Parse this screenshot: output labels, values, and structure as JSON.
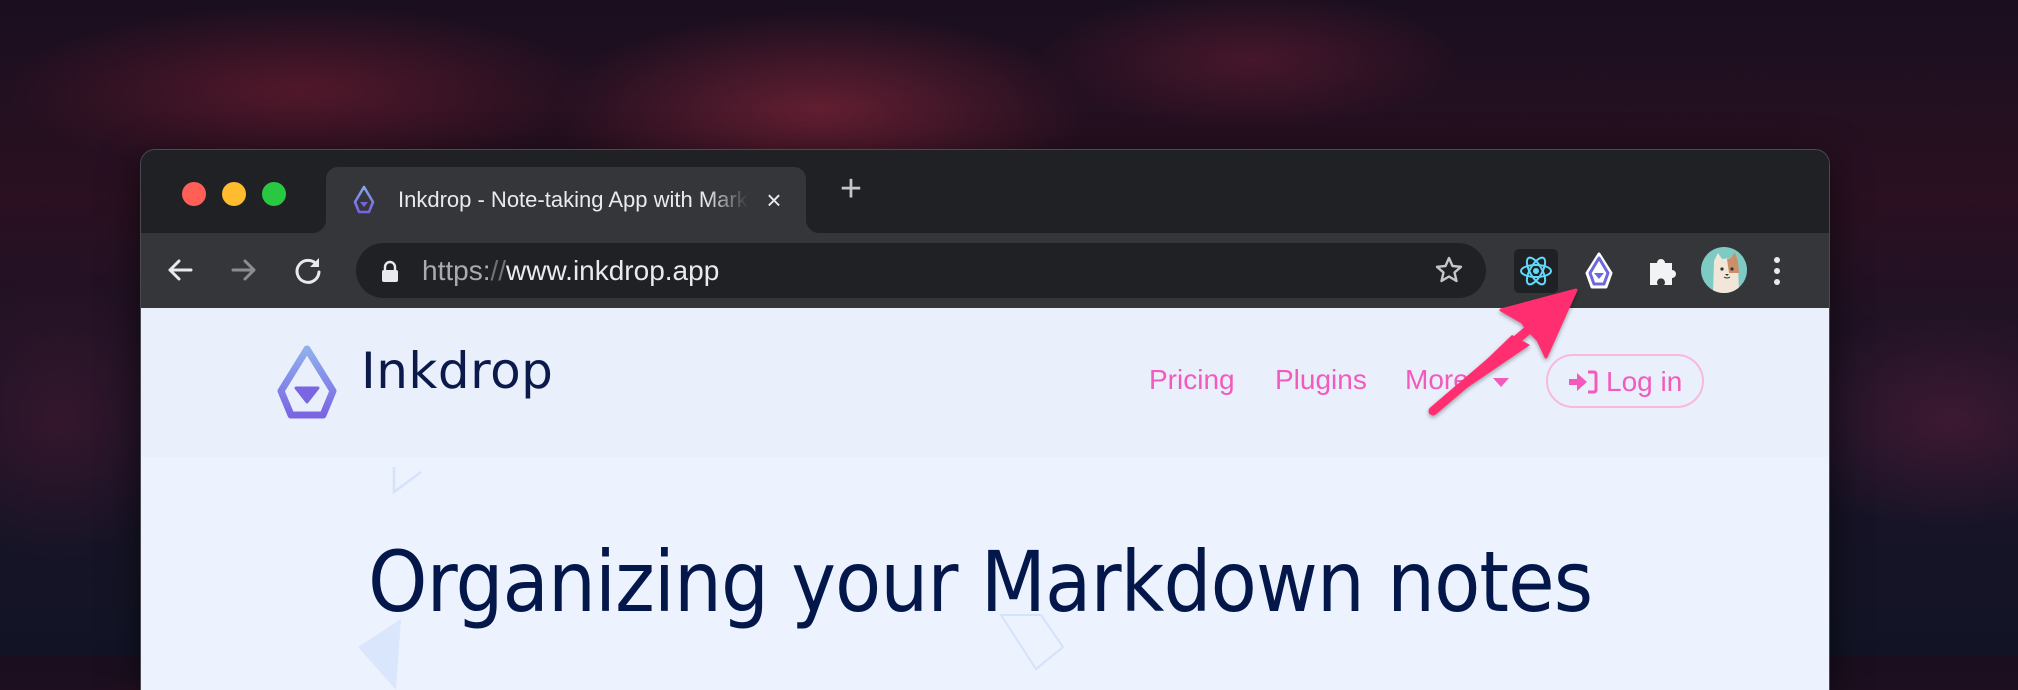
{
  "browser": {
    "tab": {
      "title": "Inkdrop - Note-taking App with Markdown",
      "favicon": "inkdrop-logo-icon",
      "close_icon": "×"
    },
    "new_tab_icon": "+",
    "omnibox": {
      "url_scheme": "https:",
      "url_separator": "//",
      "url_host": "www.inkdrop.app"
    },
    "extensions": [
      "react-devtools-icon",
      "inkdrop-extension-icon",
      "extensions-puzzle-icon"
    ],
    "profile": "avatar-dog"
  },
  "page": {
    "brand_name": "Inkdrop",
    "nav": {
      "pricing": "Pricing",
      "plugins": "Plugins",
      "more": "More"
    },
    "login_label": "Log in",
    "hero_title": "Organizing your Markdown notes"
  },
  "colors": {
    "accent_pink": "#f25bbd",
    "annotation_arrow": "#ff2d6f",
    "brand_navy": "#04174a",
    "brand_purple": "#7b6fe0"
  }
}
